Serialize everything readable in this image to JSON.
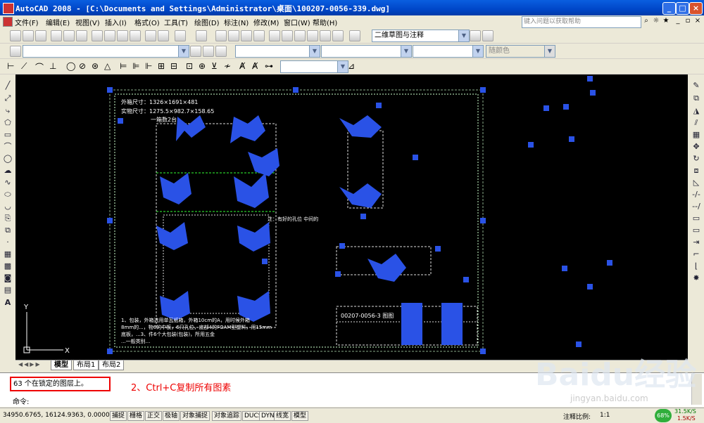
{
  "window": {
    "title": "AutoCAD 2008 - [C:\\Documents and Settings\\Administrator\\桌面\\100207-0056-339.dwg]",
    "minimize": "_",
    "maximize": "□",
    "close": "×"
  },
  "menubar": {
    "items": [
      "文件(F)",
      "编辑(E)",
      "视图(V)",
      "插入(I)",
      "格式(O)",
      "工具(T)",
      "绘图(D)",
      "标注(N)",
      "修改(M)",
      "窗口(W)",
      "帮助(H)"
    ],
    "help_placeholder": "键入问题以获取帮助"
  },
  "toolbar": {
    "workspace": "二维草图与注释",
    "layer_combo": "",
    "color_combo": "随颜色",
    "style_combo": ""
  },
  "drawing": {
    "text_lines": [
      "外箱尺寸：1326×1691×481",
      "实物尺寸：1275.5×982.7×158.65",
      "一箱数2台"
    ],
    "title_block": "00207-0056-3 图图",
    "note_right": "注：有好的孔位 中间的",
    "note_bottom": [
      "1、包装，外箱选用单瓦纸箱，外箱10cm的A，用时候外箱",
      "8mm的...，物6的中板，6只孔位，底部4的FOAM型塑料，用15mm",
      "底板，...3、件6个大包装(包装)，所用五金",
      "...一般类别..."
    ],
    "ucs_x": "X",
    "ucs_y": "Y"
  },
  "tabs": [
    "模型",
    "布局1",
    "布局2"
  ],
  "command": {
    "history": "63 个在锁定的图层上。",
    "annotation": "2、Ctrl+C复制所有图素",
    "prompt": "命令:"
  },
  "statusbar": {
    "coords": "34950.6765, 16124.9363, 0.0000",
    "toggles": [
      "捕捉",
      "栅格",
      "正交",
      "极轴",
      "对象捕捉",
      "对象追踪",
      "DUCS",
      "DYN",
      "线宽",
      "模型"
    ],
    "annotation_scale_label": "注释比例:",
    "annotation_scale": "1:1",
    "net_percent": "68%",
    "up_speed": "31.5K/S",
    "down_speed": "1.5K/S"
  },
  "watermark": {
    "brand": "Baidu经验",
    "url": "jingyan.baidu.com"
  },
  "colors": {
    "grip": "#2a52e6",
    "canvas": "#000000",
    "accent_red": "#e00000"
  }
}
